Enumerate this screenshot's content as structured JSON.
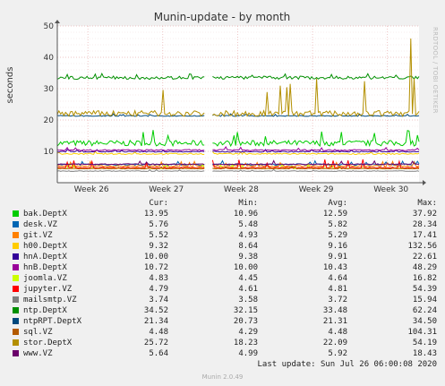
{
  "chart_data": {
    "type": "line",
    "title": "Munin-update - by month",
    "ylabel": "seconds",
    "ylim": [
      0,
      50
    ],
    "yticks": [
      10,
      20,
      30,
      40,
      50
    ],
    "xticks": [
      "Week 26",
      "Week 27",
      "Week 28",
      "Week 29",
      "Week 30"
    ],
    "grid": true,
    "side_label": "RRDTOOL / TOBI OETIKER",
    "series": [
      {
        "name": "bak.DeptX",
        "color": "#00cc00",
        "level": 12.6,
        "noise": 0.9,
        "spike": 17.0
      },
      {
        "name": "desk.VZ",
        "color": "#0066b3",
        "level": 5.8,
        "noise": 0.25,
        "spike": 7.0
      },
      {
        "name": "git.VZ",
        "color": "#ff8000",
        "level": 5.3,
        "noise": 0.2,
        "spike": 6.8
      },
      {
        "name": "h00.DeptX",
        "color": "#ffcc00",
        "level": 9.2,
        "noise": 0.2,
        "spike": 10.0
      },
      {
        "name": "hnA.DeptX",
        "color": "#330099",
        "level": 9.9,
        "noise": 0.15,
        "spike": 10.6
      },
      {
        "name": "hnB.DeptX",
        "color": "#990099",
        "level": 10.4,
        "noise": 0.2,
        "spike": 11.5
      },
      {
        "name": "joomla.VZ",
        "color": "#ccff00",
        "level": 4.6,
        "noise": 0.15,
        "spike": 6.0
      },
      {
        "name": "jupyter.VZ",
        "color": "#ff0000",
        "level": 4.8,
        "noise": 0.15,
        "spike": 7.5
      },
      {
        "name": "mailsmtp.VZ",
        "color": "#808080",
        "level": 3.7,
        "noise": 0.1,
        "spike": 4.2
      },
      {
        "name": "ntp.DeptX",
        "color": "#008f00",
        "level": 33.5,
        "noise": 0.5,
        "spike": 34.8
      },
      {
        "name": "ntpRPT.DeptX",
        "color": "#00487d",
        "level": 21.3,
        "noise": 0.15,
        "spike": 22.0
      },
      {
        "name": "sql.VZ",
        "color": "#b35a00",
        "level": 4.5,
        "noise": 0.1,
        "spike": 5.2
      },
      {
        "name": "stor.DeptX",
        "color": "#b38f00",
        "level": 22.1,
        "noise": 0.9,
        "spike": 34.0
      },
      {
        "name": "www.VZ",
        "color": "#6b006b",
        "level": 5.9,
        "noise": 0.15,
        "spike": 7.0
      }
    ],
    "gap": {
      "start_fraction": 0.41,
      "end_fraction": 0.425
    },
    "final_spike": {
      "series": "stor.DeptX",
      "value": 46.0
    }
  },
  "legend": {
    "headers": {
      "cur": "Cur:",
      "min": "Min:",
      "avg": "Avg:",
      "max": "Max:"
    },
    "rows": [
      {
        "name": "bak.DeptX",
        "cur": "13.95",
        "min": "10.96",
        "avg": "12.59",
        "max": "37.92"
      },
      {
        "name": "desk.VZ",
        "cur": "5.76",
        "min": "5.48",
        "avg": "5.82",
        "max": "28.34"
      },
      {
        "name": "git.VZ",
        "cur": "5.52",
        "min": "4.93",
        "avg": "5.29",
        "max": "17.41"
      },
      {
        "name": "h00.DeptX",
        "cur": "9.32",
        "min": "8.64",
        "avg": "9.16",
        "max": "132.56"
      },
      {
        "name": "hnA.DeptX",
        "cur": "10.00",
        "min": "9.38",
        "avg": "9.91",
        "max": "22.61"
      },
      {
        "name": "hnB.DeptX",
        "cur": "10.72",
        "min": "10.00",
        "avg": "10.43",
        "max": "48.29"
      },
      {
        "name": "joomla.VZ",
        "cur": "4.83",
        "min": "4.45",
        "avg": "4.64",
        "max": "16.82"
      },
      {
        "name": "jupyter.VZ",
        "cur": "4.79",
        "min": "4.61",
        "avg": "4.81",
        "max": "54.39"
      },
      {
        "name": "mailsmtp.VZ",
        "cur": "3.74",
        "min": "3.58",
        "avg": "3.72",
        "max": "15.94"
      },
      {
        "name": "ntp.DeptX",
        "cur": "34.52",
        "min": "32.15",
        "avg": "33.48",
        "max": "62.24"
      },
      {
        "name": "ntpRPT.DeptX",
        "cur": "21.34",
        "min": "20.73",
        "avg": "21.31",
        "max": "34.50"
      },
      {
        "name": "sql.VZ",
        "cur": "4.48",
        "min": "4.29",
        "avg": "4.48",
        "max": "104.31"
      },
      {
        "name": "stor.DeptX",
        "cur": "25.72",
        "min": "18.23",
        "avg": "22.09",
        "max": "54.19"
      },
      {
        "name": "www.VZ",
        "cur": "5.64",
        "min": "4.99",
        "avg": "5.92",
        "max": "18.43"
      }
    ]
  },
  "footer": {
    "last_update": "Last update: Sun Jul 26 06:00:08 2020",
    "version": "Munin 2.0.49"
  }
}
